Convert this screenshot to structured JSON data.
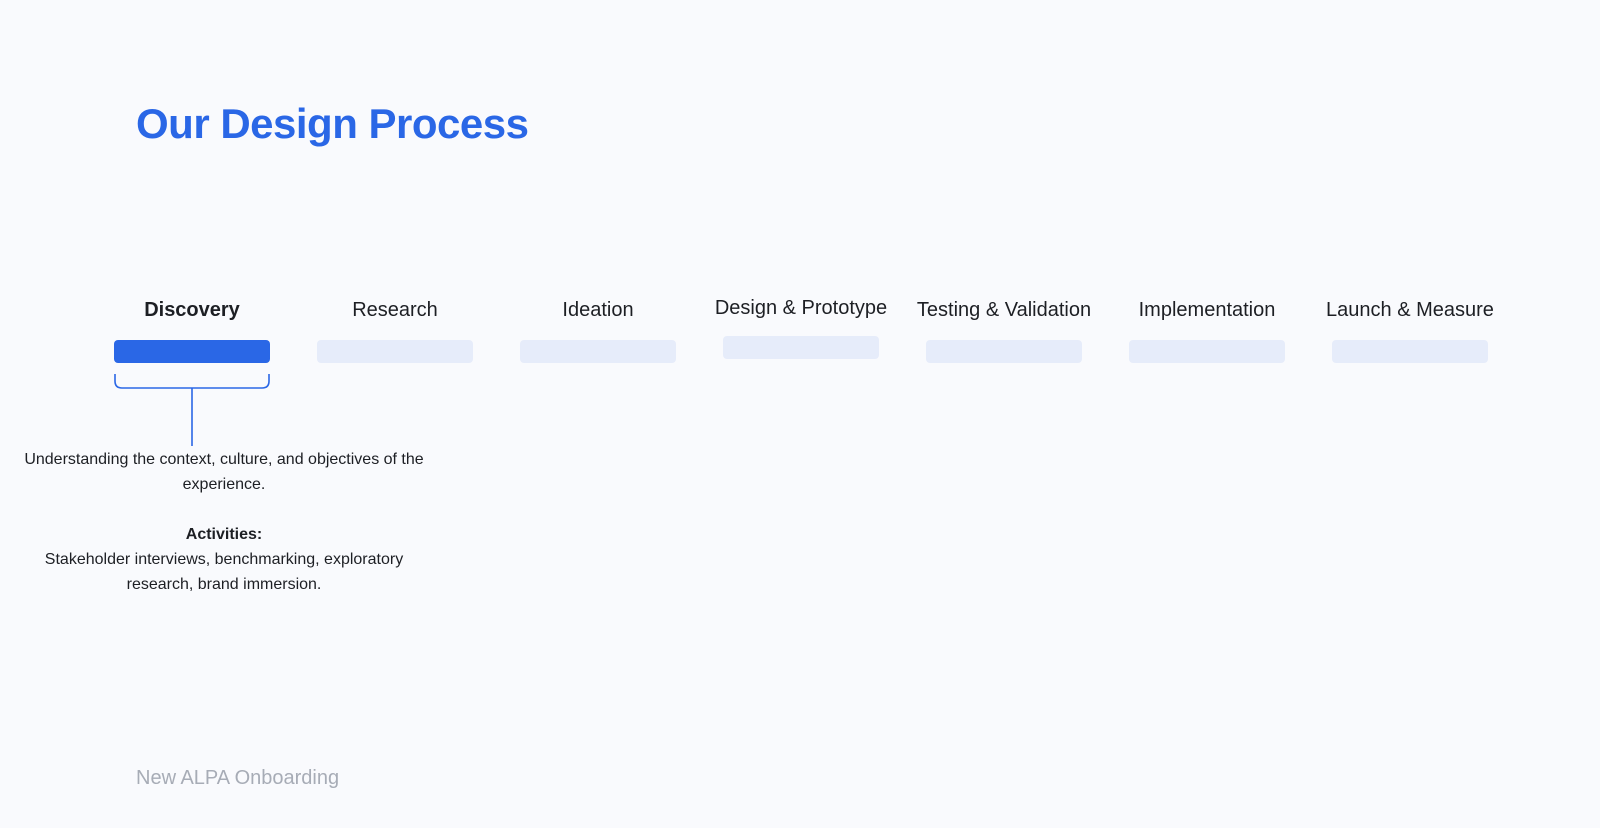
{
  "page": {
    "title": "Our Design Process",
    "footer": "New ALPA Onboarding"
  },
  "colors": {
    "accent": "#2a67e6",
    "inactive_bar": "#e6ecfa",
    "background": "#f9fafd",
    "muted_text": "#a7acb6"
  },
  "process": {
    "steps": [
      {
        "label": "Discovery",
        "active": true
      },
      {
        "label": "Research",
        "active": false
      },
      {
        "label": "Ideation",
        "active": false
      },
      {
        "label": "Design & Prototype",
        "active": false
      },
      {
        "label": "Testing & Validation",
        "active": false
      },
      {
        "label": "Implementation",
        "active": false
      },
      {
        "label": "Launch & Measure",
        "active": false
      }
    ]
  },
  "detail": {
    "description": "Understanding the context, culture, and objectives of the experience.",
    "activities_heading": "Activities:",
    "activities_text": "Stakeholder interviews, benchmarking, exploratory research, brand immersion."
  }
}
